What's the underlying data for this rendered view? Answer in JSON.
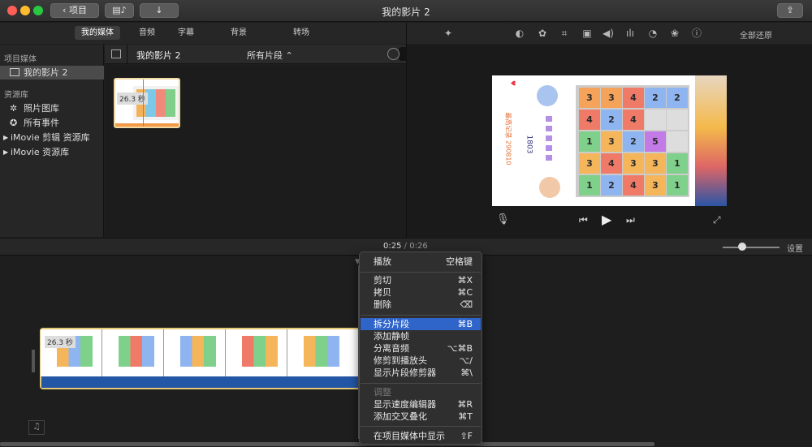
{
  "window": {
    "title": "我的影片 2",
    "back_label": "项目",
    "colors": {
      "close": "#fe5f57",
      "minimize": "#febc2e",
      "zoom": "#28c840"
    }
  },
  "tabs": [
    {
      "label": "我的媒体",
      "active": true
    },
    {
      "label": "音频",
      "active": false
    },
    {
      "label": "字幕",
      "active": false
    },
    {
      "label": "背景",
      "active": false
    },
    {
      "label": "转场",
      "active": false
    }
  ],
  "adjust": {
    "reset_all": "全部还原",
    "icons": [
      "magic-wand-icon",
      "color-balance-icon",
      "color-correction-icon",
      "crop-icon",
      "stabilization-icon",
      "volume-icon",
      "noise-reduction-icon",
      "speed-icon",
      "clip-filter-icon",
      "info-icon"
    ]
  },
  "sidebar": {
    "section_project": "项目媒体",
    "project_item": "我的影片 2",
    "section_library": "资源库",
    "items": [
      "照片图库",
      "所有事件",
      "iMovie 剪辑 资源库",
      "iMovie 资源库"
    ]
  },
  "browser": {
    "title": "我的影片 2",
    "filter": "所有片段",
    "search_placeholder": "搜索",
    "clip_duration": "26.3 秒"
  },
  "viewer": {
    "puzzle_rows": [
      [
        "3",
        "3",
        "4",
        "2",
        "2"
      ],
      [
        "4",
        "2",
        "4",
        "",
        ""
      ],
      [
        "1",
        "3",
        "2",
        "5",
        ""
      ],
      [
        "3",
        "4",
        "3",
        "3",
        "1"
      ],
      [
        "1",
        "2",
        "4",
        "3",
        "1"
      ]
    ],
    "score_text": "最高记录 290810",
    "score_num": "1803"
  },
  "timeline": {
    "current": "0:25",
    "separator": "/",
    "total": "0:26",
    "settings": "设置",
    "clip_duration": "26.3 秒",
    "zoom_level": 0.34
  },
  "context_menu": {
    "groups": [
      [
        {
          "label": "播放",
          "shortcut": "空格键"
        }
      ],
      [
        {
          "label": "剪切",
          "shortcut": "⌘X"
        },
        {
          "label": "拷贝",
          "shortcut": "⌘C"
        },
        {
          "label": "删除",
          "shortcut": "⌫"
        }
      ],
      [
        {
          "label": "拆分片段",
          "shortcut": "⌘B",
          "highlighted": true
        },
        {
          "label": "添加静帧",
          "shortcut": ""
        },
        {
          "label": "分离音频",
          "shortcut": "⌥⌘B"
        },
        {
          "label": "修剪到播放头",
          "shortcut": "⌥/"
        },
        {
          "label": "显示片段修剪器",
          "shortcut": "⌘\\"
        }
      ],
      [
        {
          "label": "调整",
          "shortcut": "",
          "disabled": true
        },
        {
          "label": "显示速度编辑器",
          "shortcut": "⌘R"
        },
        {
          "label": "添加交叉叠化",
          "shortcut": "⌘T"
        }
      ],
      [
        {
          "label": "在项目媒体中显示",
          "shortcut": "⇧F"
        }
      ]
    ]
  }
}
